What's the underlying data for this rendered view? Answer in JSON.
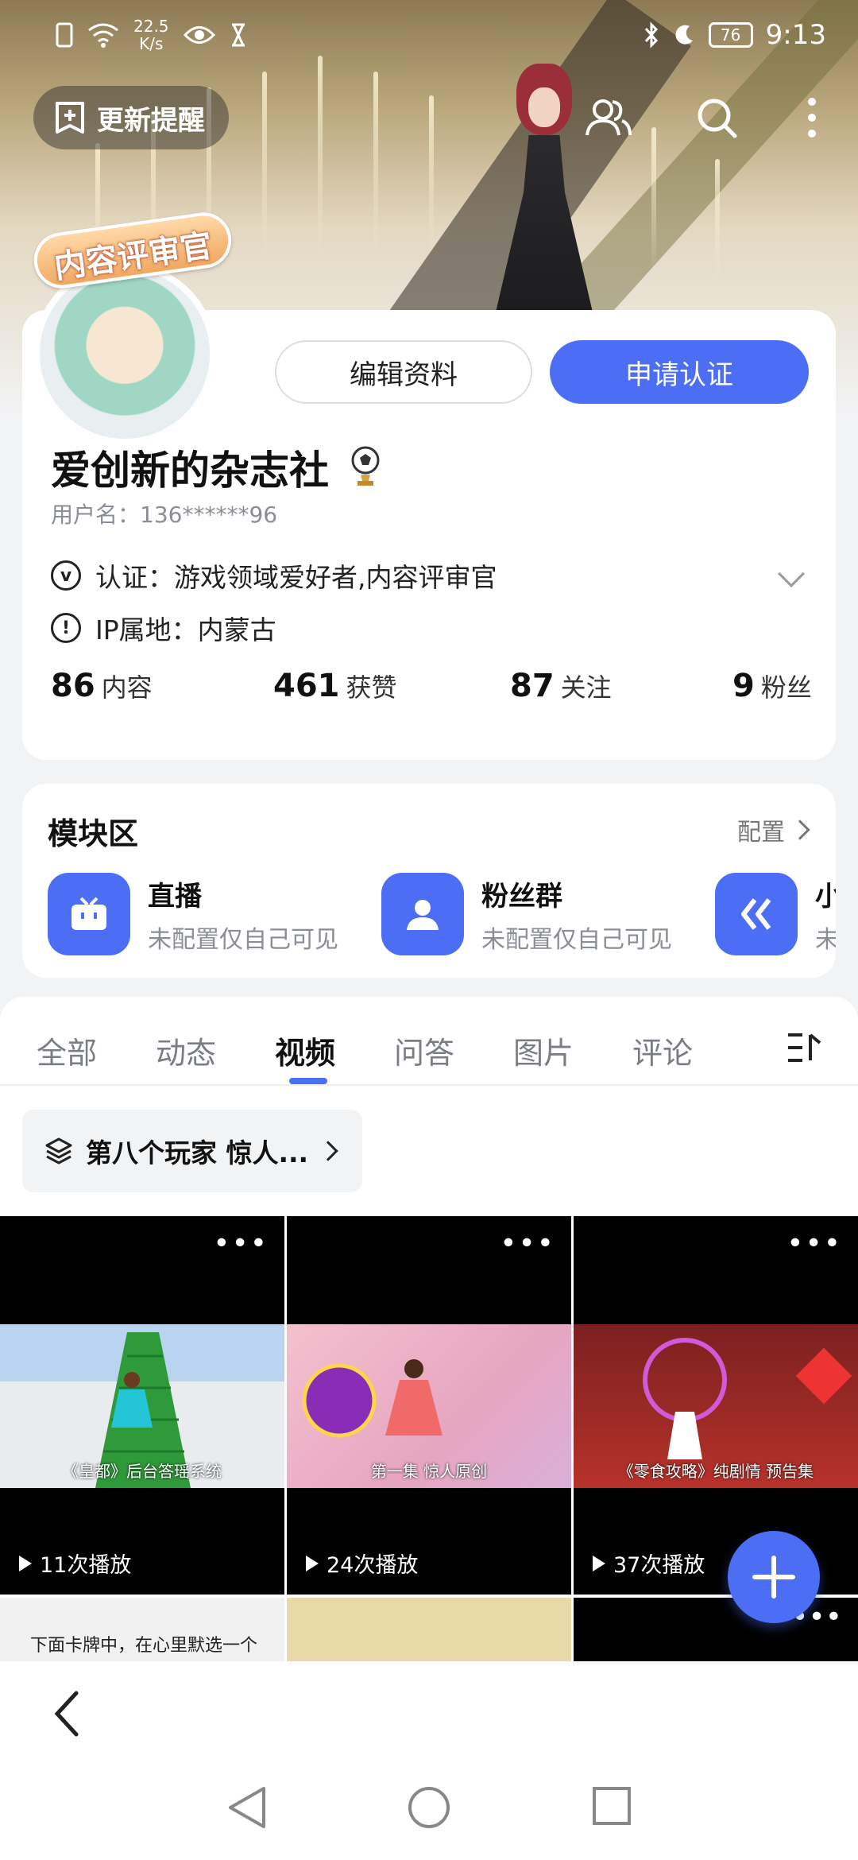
{
  "status_bar": {
    "net_speed_value": "22.5",
    "net_speed_unit": "K/s",
    "battery": "76",
    "time": "9:13"
  },
  "header": {
    "update_reminder_label": "更新提醒"
  },
  "badge_text": "内容评审官",
  "profile": {
    "edit_button": "编辑资料",
    "apply_button": "申请认证",
    "name": "爱创新的杂志社",
    "username": "用户名：136******96",
    "certification": "认证：游戏领域爱好者,内容评审官",
    "ip_location": "IP属地：内蒙古",
    "stats": [
      {
        "num": "86",
        "label": "内容"
      },
      {
        "num": "461",
        "label": "获赞"
      },
      {
        "num": "87",
        "label": "关注"
      },
      {
        "num": "9",
        "label": "粉丝"
      }
    ]
  },
  "modules": {
    "title": "模块区",
    "config_label": "配置",
    "items": [
      {
        "name": "直播",
        "sub": "未配置仅自己可见"
      },
      {
        "name": "粉丝群",
        "sub": "未配置仅自己可见"
      },
      {
        "name": "小",
        "sub": "未"
      }
    ]
  },
  "tabs": [
    "全部",
    "动态",
    "视频",
    "问答",
    "图片",
    "评论"
  ],
  "active_tab": "视频",
  "collection_chip": "第八个玩家 惊人...",
  "videos": [
    {
      "plays": "11次播放",
      "caption": "《皇都》后台答瑶系统"
    },
    {
      "plays": "24次播放",
      "caption": "第一集 惊人原创"
    },
    {
      "plays": "37次播放",
      "caption": "《零食攻略》纯剧情 预告集"
    }
  ],
  "second_row_caption": "下面卡牌中，在心里默选一个",
  "colors": {
    "accent": "#4c6ef5"
  }
}
